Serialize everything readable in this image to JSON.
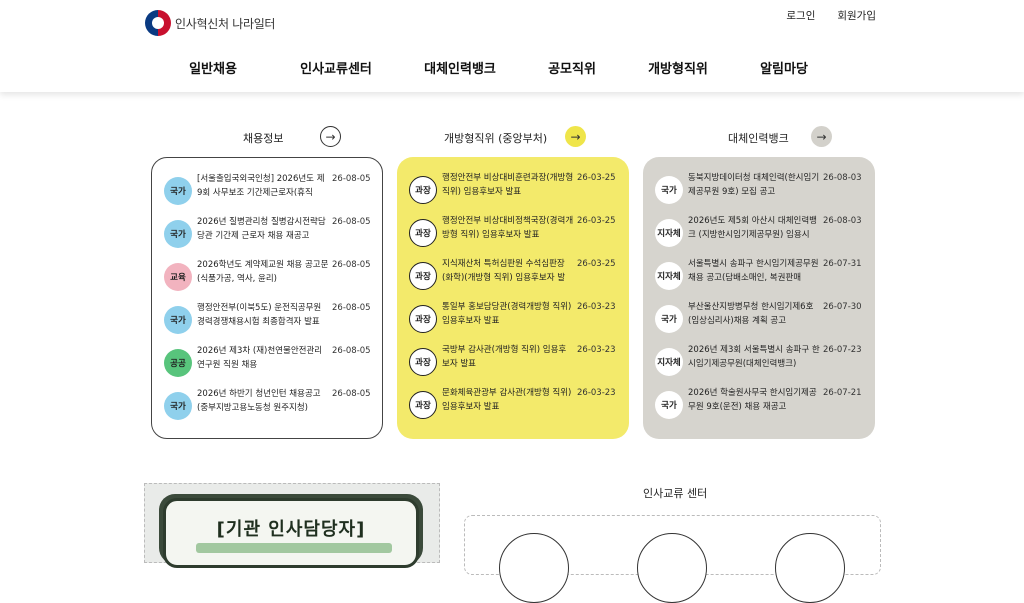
{
  "logo": {
    "text": "인사혁신처 나라일터"
  },
  "util": {
    "login": "로그인",
    "signup": "회원가입"
  },
  "gnb": [
    "일반채용",
    "인사교류센터",
    "대체인력뱅크",
    "공모직위",
    "개방형직위",
    "알림마당"
  ],
  "columns": [
    {
      "title": "채용정보",
      "items": [
        {
          "badge": "국가",
          "text": "[서울출입국외국인청] 2026년도 제9회 사무보조 기간제근로자(휴직",
          "date": "26-08-05"
        },
        {
          "badge": "국가",
          "text": "2026년 질병관리청 질병감시전략담당관 기간제 근로자 채용 재공고",
          "date": "26-08-05"
        },
        {
          "badge": "교육",
          "text": "2026학년도 계약제교원 채용 공고문(식품가공, 역사, 윤리)",
          "date": "26-08-05"
        },
        {
          "badge": "국가",
          "text": "행정안전부(이북5도) 운전직공무원 경력경쟁채용시험 최종합격자 발표",
          "date": "26-08-05"
        },
        {
          "badge": "공공",
          "text": "2026년 제3차 (재)천연물안전관리연구원 직원 채용",
          "date": "26-08-05"
        },
        {
          "badge": "국가",
          "text": "2026년 하반기 청년인턴 채용공고(중부지방고용노동청 원주지청)",
          "date": "26-08-05"
        }
      ]
    },
    {
      "title": "개방형직위 (중앙부처)",
      "items": [
        {
          "badge": "과장",
          "text": "행정안전부 비상대비훈련과장(개방형 직위) 임용후보자 발표",
          "date": "26-03-25"
        },
        {
          "badge": "과장",
          "text": "행정안전부 비상대비정책국장(경력개방형 직위) 임용후보자 발표",
          "date": "26-03-25"
        },
        {
          "badge": "과장",
          "text": "지식재산처 특허심판원 수석심판장(화학)(개방형 직위) 임용후보자 발",
          "date": "26-03-25"
        },
        {
          "badge": "과장",
          "text": "통일부 홍보담당관(경력개방형 직위) 임용후보자 발표",
          "date": "26-03-23"
        },
        {
          "badge": "과장",
          "text": "국방부 감사관(개방형 직위) 임용후보자 발표",
          "date": "26-03-23"
        },
        {
          "badge": "과장",
          "text": "문화체육관광부 감사관(개방형 직위) 임용후보자 발표",
          "date": "26-03-23"
        }
      ]
    },
    {
      "title": "대체인력뱅크",
      "items": [
        {
          "badge": "국가",
          "text": "동북지방데이터청 대체인력(한시임기제공무원 9호) 모집 공고",
          "date": "26-08-03"
        },
        {
          "badge": "지자체",
          "text": "2026년도 제5회 아산시 대체인력뱅크 (지방한시임기제공무원) 임용시",
          "date": "26-08-03"
        },
        {
          "badge": "지자체",
          "text": "서울특별시 송파구 한시임기제공무원 채용 공고(담배소매인, 복권판매",
          "date": "26-07-31"
        },
        {
          "badge": "국가",
          "text": "부산울산지방병무청 한시임기제6호(임상심리사)채용 계획 공고",
          "date": "26-07-30"
        },
        {
          "badge": "지자체",
          "text": "2026년 제3회 서울특별시 송파구 한시임기제공무원(대체인력뱅크)",
          "date": "26-07-23"
        },
        {
          "badge": "국가",
          "text": "2026년 학술원사무국 한시임기제공무원 9호(운전) 채용 재공고",
          "date": "26-07-21"
        }
      ]
    }
  ],
  "section2": {
    "title": "인사교류 센터"
  },
  "banner": {
    "text": "[기관 인사담당자]"
  },
  "colors": {
    "yellow": "#f3ea6b",
    "gray": "#d6d4ce",
    "blue_badge": "#8fd0ec",
    "pink_badge": "#f2b3bf",
    "green_badge": "#58c47c"
  }
}
